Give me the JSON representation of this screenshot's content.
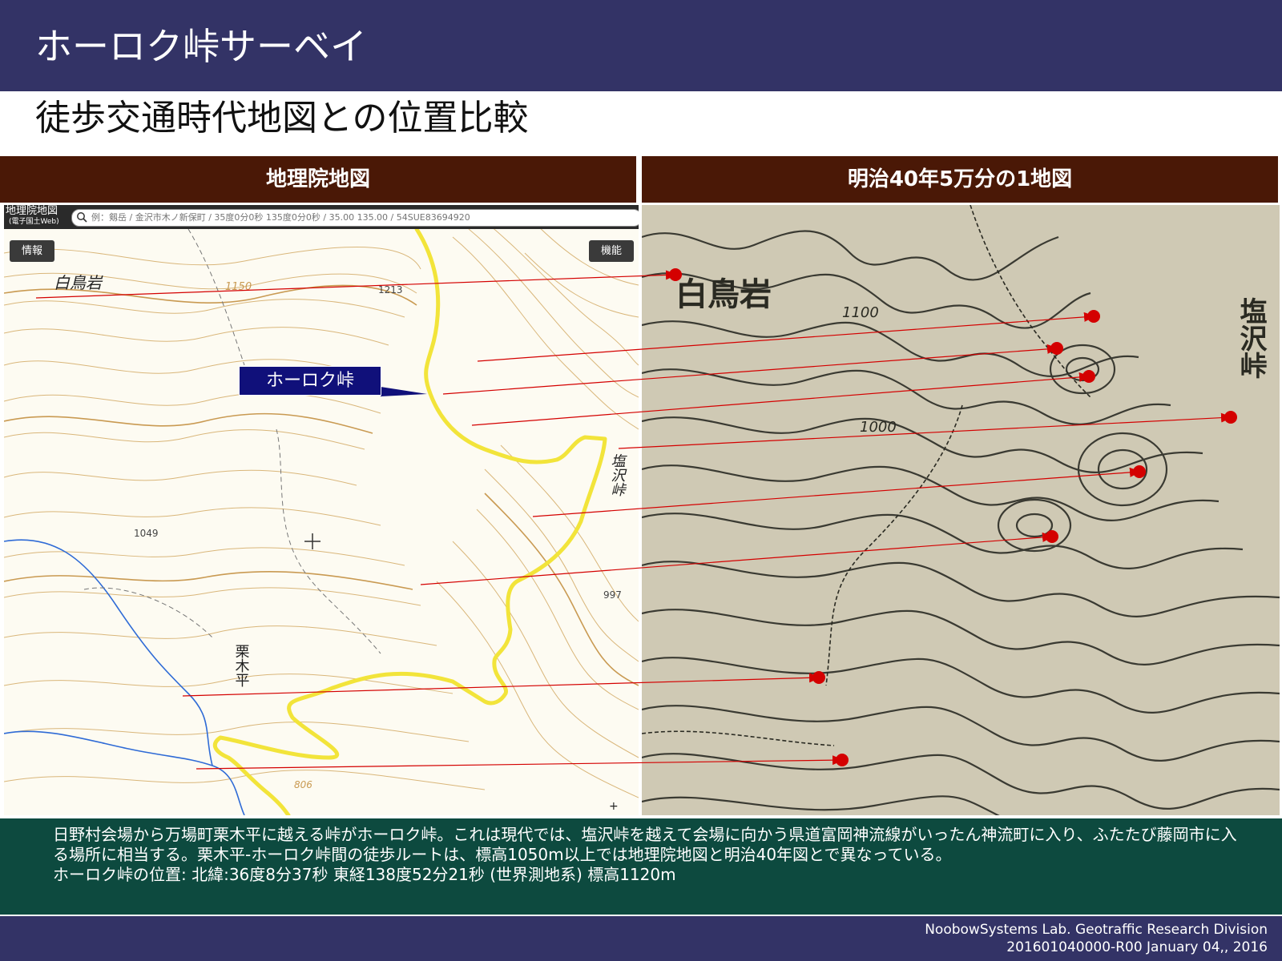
{
  "header": {
    "title": "ホーロク峠サーベイ",
    "subtitle": "徒歩交通時代地図との位置比較"
  },
  "panels": {
    "left_title": "地理院地図",
    "right_title": "明治40年5万分の1地図"
  },
  "gsi_map": {
    "logo": "地理院地図",
    "logo_sub": "(電子国土Web)",
    "search_placeholder": "例：剱岳 / 金沢市木ノ新保町 / 35度0分0秒 135度0分0秒 / 35.00 135.00 / 54SUE83694920",
    "info_button": "情報",
    "function_button": "機能",
    "place_white_tori_rock": "白鳥岩",
    "place_shiozawa_pass": "塩沢峠",
    "place_kurikidaira": "栗木平",
    "elev_1213": "1213",
    "elev_1150": "1150",
    "elev_1049": "1049",
    "elev_997": "997",
    "elev_806": "806",
    "zoom_plus": "+"
  },
  "callout": {
    "label": "ホーロク峠"
  },
  "old_map": {
    "place_white_tori_rock": "白鳥岩",
    "place_shiozawa_pass": "塩沢峠",
    "contour_1100": "1100",
    "contour_1000": "1000"
  },
  "caption": {
    "paragraph": "日野村会場から万場町栗木平に越える峠がホーロク峠。これは現代では、塩沢峠を越えて会場に向かう県道富岡神流線がいったん神流町に入り、ふたたび藤岡市に入る場所に相当する。栗木平-ホーロク峠間の徒歩ルートは、標高1050m以上では地理院地図と明治40年図とで異なっている。",
    "location": "ホーロク峠の位置:  北緯:36度8分37秒 東経138度52分21秒 (世界測地系)  標高1120m"
  },
  "footer": {
    "org": "NoobowSystems Lab. Geotraffic Research Division",
    "doc_id": "201601040000-R00 January 04,, 2016"
  },
  "colors": {
    "top_bar": "#333366",
    "panel_header": "#4a1806",
    "caption_bg": "#0d4a3f",
    "road_yellow": "#f2e43a",
    "arrow_red": "#d40000",
    "callout_blue": "#10107a"
  }
}
